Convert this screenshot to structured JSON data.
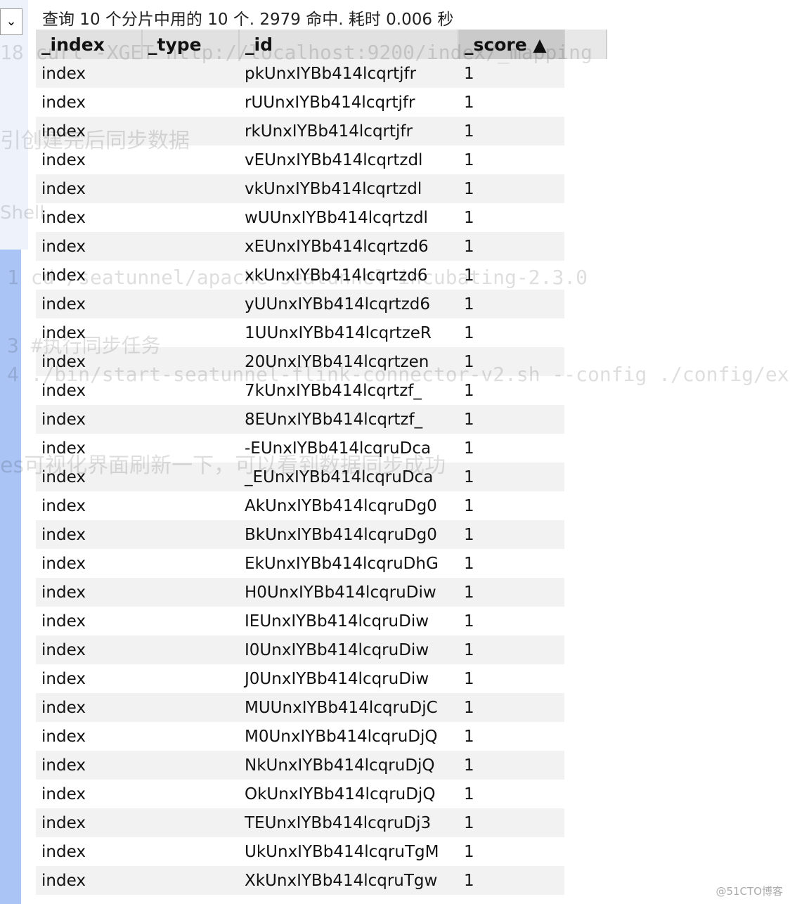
{
  "summary": "查询 10 个分片中用的 10 个. 2979 命中. 耗时 0.006 秒",
  "dropdown_icon": "chevron-down-icon",
  "columns": [
    "_index",
    "_type",
    "_id",
    "_score ▲"
  ],
  "rows": [
    {
      "index": "index",
      "id": "pkUnxIYBb414lcqrtjfr",
      "score": "1"
    },
    {
      "index": "index",
      "id": "rUUnxIYBb414lcqrtjfr",
      "score": "1"
    },
    {
      "index": "index",
      "id": "rkUnxIYBb414lcqrtjfr",
      "score": "1"
    },
    {
      "index": "index",
      "id": "vEUnxIYBb414lcqrtzdl",
      "score": "1"
    },
    {
      "index": "index",
      "id": "vkUnxIYBb414lcqrtzdl",
      "score": "1"
    },
    {
      "index": "index",
      "id": "wUUnxIYBb414lcqrtzdl",
      "score": "1"
    },
    {
      "index": "index",
      "id": "xEUnxIYBb414lcqrtzd6",
      "score": "1"
    },
    {
      "index": "index",
      "id": "xkUnxIYBb414lcqrtzd6",
      "score": "1"
    },
    {
      "index": "index",
      "id": "yUUnxIYBb414lcqrtzd6",
      "score": "1"
    },
    {
      "index": "index",
      "id": "1UUnxIYBb414lcqrtzeR",
      "score": "1"
    },
    {
      "index": "index",
      "id": "20UnxIYBb414lcqrtzen",
      "score": "1"
    },
    {
      "index": "index",
      "id": "7kUnxIYBb414lcqrtzf_",
      "score": "1"
    },
    {
      "index": "index",
      "id": "8EUnxIYBb414lcqrtzf_",
      "score": "1"
    },
    {
      "index": "index",
      "id": "-EUnxIYBb414lcqruDca",
      "score": "1"
    },
    {
      "index": "index",
      "id": "_EUnxIYBb414lcqruDca",
      "score": "1"
    },
    {
      "index": "index",
      "id": "AkUnxIYBb414lcqruDg0",
      "score": "1"
    },
    {
      "index": "index",
      "id": "BkUnxIYBb414lcqruDg0",
      "score": "1"
    },
    {
      "index": "index",
      "id": "EkUnxIYBb414lcqruDhG",
      "score": "1"
    },
    {
      "index": "index",
      "id": "H0UnxIYBb414lcqruDiw",
      "score": "1"
    },
    {
      "index": "index",
      "id": "IEUnxIYBb414lcqruDiw",
      "score": "1"
    },
    {
      "index": "index",
      "id": "I0UnxIYBb414lcqruDiw",
      "score": "1"
    },
    {
      "index": "index",
      "id": "J0UnxIYBb414lcqruDiw",
      "score": "1"
    },
    {
      "index": "index",
      "id": "MUUnxIYBb414lcqruDjC",
      "score": "1"
    },
    {
      "index": "index",
      "id": "M0UnxIYBb414lcqruDjQ",
      "score": "1"
    },
    {
      "index": "index",
      "id": "NkUnxIYBb414lcqruDjQ",
      "score": "1"
    },
    {
      "index": "index",
      "id": "OkUnxIYBb414lcqruDjQ",
      "score": "1"
    },
    {
      "index": "index",
      "id": "TEUnxIYBb414lcqruDj3",
      "score": "1"
    },
    {
      "index": "index",
      "id": "UkUnxIYBb414lcqruTgM",
      "score": "1"
    },
    {
      "index": "index",
      "id": "XkUnxIYBb414lcqruTgw",
      "score": "1"
    }
  ],
  "background_text": [
    "18  curl -XGET http://localhost:9200/index/_mapping",
    "引创建完后同步数据",
    "Shell",
    "1  cd /seatunnel/apache-seatunnel-incubating-2.3.0",
    "3  #执行同步任务",
    "4  ./bin/start-seatunnel-flink-connector-v2.sh --config ./config/ex",
    "es可视化界面刷新一下，可以看到数据同步成功"
  ],
  "watermark": "@51CTO博客"
}
